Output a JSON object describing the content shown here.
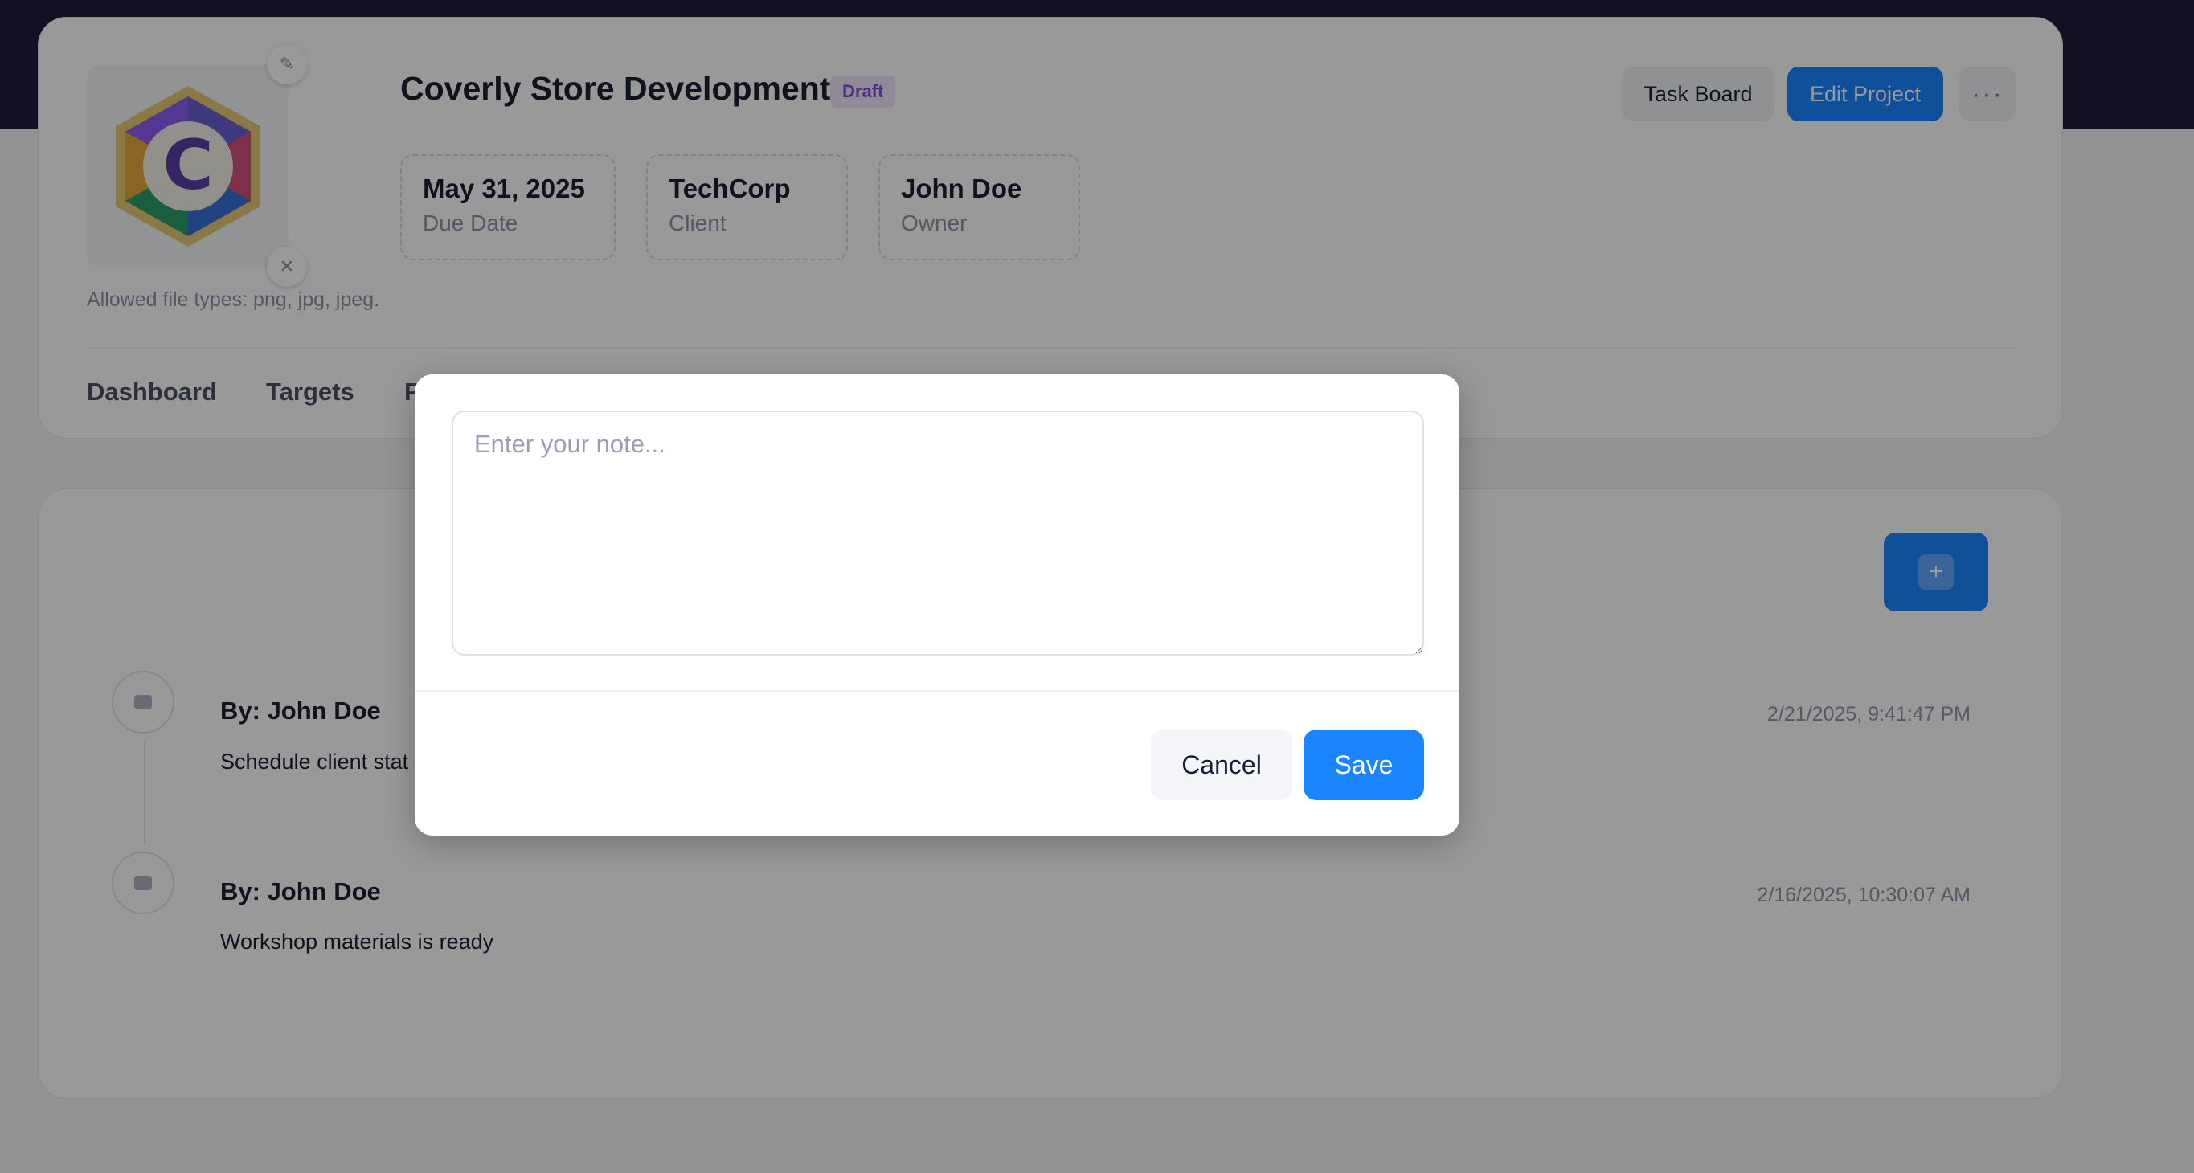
{
  "project": {
    "title": "Coverly Store Development",
    "status": "Draft",
    "logo_letter": "C",
    "file_hint": "Allowed file types: png, jpg, jpeg.",
    "stats": [
      {
        "value": "May 31, 2025",
        "label": "Due Date"
      },
      {
        "value": "TechCorp",
        "label": "Client"
      },
      {
        "value": "John Doe",
        "label": "Owner"
      }
    ]
  },
  "toolbar": {
    "task_board_label": "Task Board",
    "edit_project_label": "Edit Project",
    "more_label": "···"
  },
  "tabs": [
    "Dashboard",
    "Targets",
    "P"
  ],
  "notes_section": {
    "add_label": "+",
    "notes": [
      {
        "author": "By: John Doe",
        "text": "Schedule client stat",
        "time": "2/21/2025, 9:41:47 PM"
      },
      {
        "author": "By: John Doe",
        "text": "Workshop materials is ready",
        "time": "2/16/2025, 10:30:07 AM"
      }
    ]
  },
  "modal": {
    "placeholder": "Enter your note...",
    "value": "",
    "cancel_label": "Cancel",
    "save_label": "Save"
  },
  "colors": {
    "top_band": "#1f1d3d",
    "primary": "#1b84ff",
    "badge_bg": "#efe7fb",
    "badge_text": "#7e4fd6",
    "overlay": "rgba(0,0,0,0.4)"
  },
  "icons": {
    "logo_edit": "pencil-icon",
    "logo_remove": "close-icon",
    "more": "more-horizontal-icon",
    "note": "chat-bubble-icon",
    "add": "plus-icon"
  }
}
